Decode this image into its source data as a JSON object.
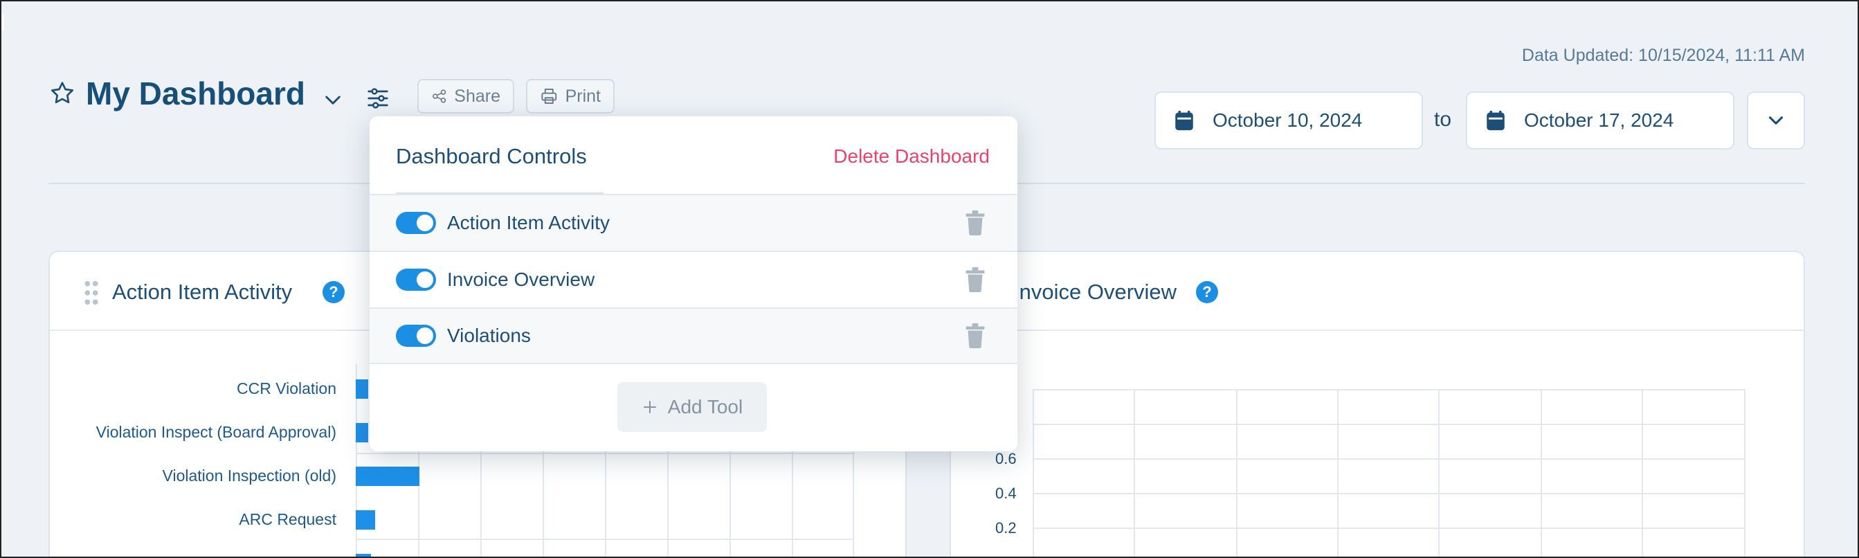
{
  "header": {
    "title": "My Dashboard",
    "share_label": "Share",
    "print_label": "Print",
    "data_updated": "Data Updated: 10/15/2024, 11:11 AM",
    "date_from": "October 10, 2024",
    "date_to": "October 17, 2024",
    "to_label": "to"
  },
  "popup": {
    "title": "Dashboard Controls",
    "delete_label": "Delete Dashboard",
    "items": [
      {
        "label": "Action Item Activity",
        "enabled": true
      },
      {
        "label": "Invoice Overview",
        "enabled": true
      },
      {
        "label": "Violations",
        "enabled": true
      }
    ],
    "add_tool_label": "Add Tool"
  },
  "widgets": {
    "left": {
      "title": "Action Item Activity",
      "help": "?",
      "bars": [
        {
          "label": "CCR Violation",
          "value": 0.2
        },
        {
          "label": "Violation Inspect (Board Approval)",
          "value": 0.2
        },
        {
          "label": "Violation Inspection (old)",
          "value": 1
        },
        {
          "label": "ARC Request",
          "value": 0.3
        }
      ]
    },
    "right": {
      "title": "Invoice Overview",
      "help": "?",
      "yticks": [
        "0.6",
        "0.4",
        "0.2"
      ]
    }
  },
  "colors": {
    "accent": "#1a8fe3",
    "danger": "#e8426e",
    "title": "#16507a"
  }
}
